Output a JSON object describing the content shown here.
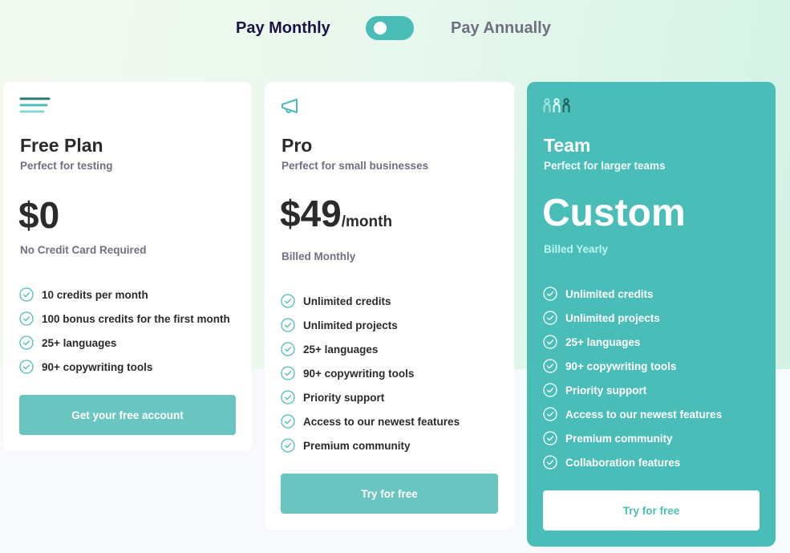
{
  "billing_toggle": {
    "monthly_label": "Pay Monthly",
    "annually_label": "Pay Annually",
    "selected": "monthly",
    "accent_color": "#4bbdb8"
  },
  "plans": [
    {
      "id": "free",
      "icon": "lines-icon",
      "name": "Free Plan",
      "subtitle": "Perfect for testing",
      "price": "$0",
      "price_unit": "",
      "billing_note": "No Credit Card Required",
      "features": [
        "10 credits per month",
        "100 bonus credits for the first month",
        "25+ languages",
        "90+ copywriting tools"
      ],
      "cta_label": "Get your free account"
    },
    {
      "id": "pro",
      "icon": "megaphone-icon",
      "name": "Pro",
      "subtitle": "Perfect for small businesses",
      "price": "$49",
      "price_unit": "/month",
      "billing_note": "Billed Monthly",
      "features": [
        "Unlimited credits",
        "Unlimited projects",
        "25+ languages",
        "90+ copywriting tools",
        "Priority support",
        "Access to our newest features",
        "Premium community"
      ],
      "cta_label": "Try for free"
    },
    {
      "id": "team",
      "icon": "team-icon",
      "name": "Team",
      "subtitle": "Perfect for larger teams",
      "price": "Custom",
      "price_unit": "",
      "billing_note": "Billed Yearly",
      "features": [
        "Unlimited credits",
        "Unlimited projects",
        "25+ languages",
        "90+ copywriting tools",
        "Priority support",
        "Access to our newest features",
        "Premium community",
        "Collaboration features"
      ],
      "cta_label": "Try for free"
    }
  ],
  "colors": {
    "accent": "#4bbdb8",
    "button": "#6ac4c0",
    "heading": "#2b2b2b",
    "muted": "#6f7080",
    "toggle_active_text": "#1a1446"
  }
}
